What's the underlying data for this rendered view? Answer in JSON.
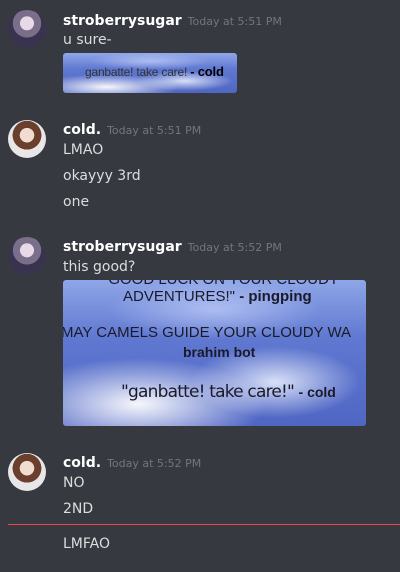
{
  "messages": [
    {
      "username": "stroberrysugar",
      "timestamp": "Today at 5:51 PM",
      "lines": [
        "u sure-"
      ],
      "image_caption": {
        "text": "ganbatte! take care!",
        "author": "- cold"
      }
    },
    {
      "username": "cold.",
      "timestamp": "Today at 5:51 PM",
      "lines": [
        "LMAO",
        "okayyy 3rd",
        "one"
      ]
    },
    {
      "username": "stroberrysugar",
      "timestamp": "Today at 5:52 PM",
      "lines": [
        "this good?"
      ],
      "image_caption": {
        "cutoff_top": "\"GOOD LUCK ON YOUR CLOUDY",
        "line1": "ADVENTURES!\"",
        "line1_author": "- pingping",
        "line2": "MAY CAMELS GUIDE YOUR CLOUDY WA",
        "line2_author": "brahim bot",
        "line3": "\"ganbatte! take care!\"",
        "line3_author": "- cold"
      }
    },
    {
      "username": "cold.",
      "timestamp": "Today at 5:52 PM",
      "lines": [
        "NO",
        "2ND",
        "LMFAO"
      ]
    }
  ],
  "colors": {
    "background": "#36393f",
    "username": "#ffffff",
    "timestamp": "#72767d",
    "new_divider": "#f04747"
  }
}
